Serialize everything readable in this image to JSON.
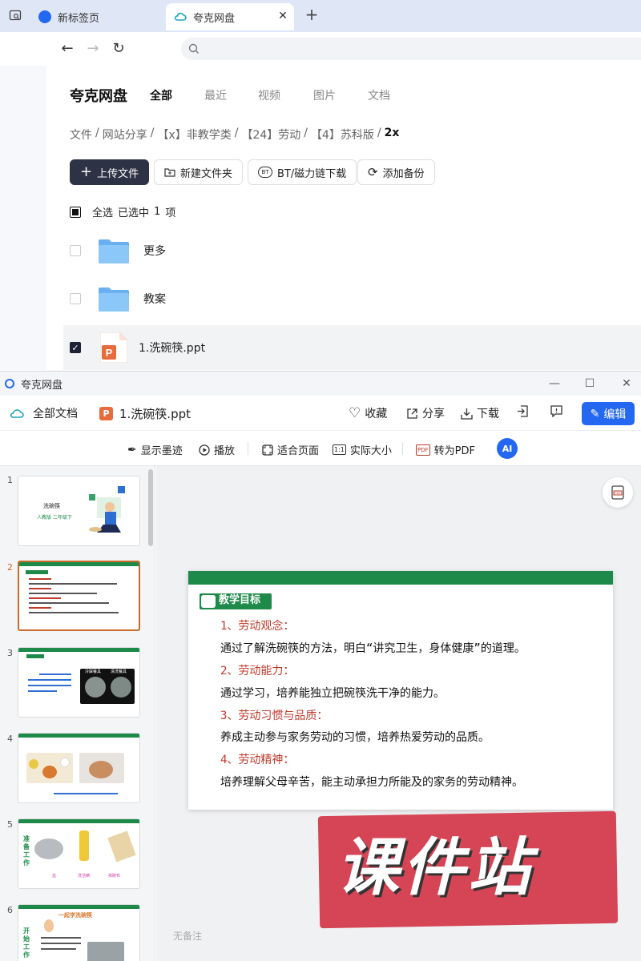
{
  "browser": {
    "tabs": [
      {
        "label": "新标签页"
      },
      {
        "label": "夸克网盘",
        "close": "✕"
      }
    ],
    "new_tab": "+"
  },
  "drive": {
    "brand": "夸克网盘",
    "nav": [
      "全部",
      "最近",
      "视频",
      "图片",
      "文档"
    ],
    "breadcrumb": [
      "文件",
      "/",
      "网站分享",
      "/",
      "【x】非教学类",
      "/",
      "【24】劳动",
      "/",
      "【4】苏科版",
      "/",
      "2x"
    ],
    "actions": {
      "upload": "上传文件",
      "new_folder": "新建文件夹",
      "bt": "BT/磁力链下载",
      "backup": "添加备份"
    },
    "selection": {
      "select_all": "全选",
      "selected": "已选中",
      "count": "1",
      "unit": "项"
    },
    "files": [
      {
        "name": "更多",
        "type": "folder",
        "checked": false
      },
      {
        "name": "教案",
        "type": "folder",
        "checked": false
      },
      {
        "name": "1.洗碗筷.ppt",
        "type": "ppt",
        "checked": true
      }
    ]
  },
  "viewer": {
    "window_title": "夸克网盘",
    "win_controls": {
      "min": "—",
      "max": "☐",
      "close": "✕"
    },
    "all_docs": "全部文档",
    "file_name": "1.洗碗筷.ppt",
    "toolbar": {
      "favorite": "收藏",
      "share": "分享",
      "download": "下载",
      "edit": "编辑"
    },
    "toolbar2": {
      "ink": "显示墨迹",
      "play": "播放",
      "fit": "适合页面",
      "actual": "实际大小",
      "pdf": "转为PDF",
      "ai": "AI"
    },
    "thumb_numbers": [
      "1",
      "2",
      "3",
      "4",
      "5",
      "6"
    ],
    "thumb1": {
      "title": "洗碗筷",
      "sub": "人教版 二年级下"
    },
    "thumb3": {
      "label1": "冷踩餐具",
      "label2": "清洗餐具"
    },
    "thumb5": {
      "side": "准备工作",
      "items": [
        "盆",
        "洗洁精",
        "抹碗布"
      ]
    },
    "thumb6": {
      "title": "一起学洗碗筷",
      "side": "开始工作"
    },
    "notes": "无备注"
  },
  "slide": {
    "ribbon": "教学目标",
    "items": [
      {
        "heading": "1、劳动观念：",
        "body": "通过了解洗碗筷的方法，明白“讲究卫生，身体健康”的道理。"
      },
      {
        "heading": "2、劳动能力：",
        "body": "通过学习，培养能独立把碗筷洗干净的能力。"
      },
      {
        "heading": "3、劳动习惯与品质：",
        "body": "养成主动参与家务劳动的习惯，培养热爱劳动的品质。"
      },
      {
        "heading": "4、劳动精神：",
        "body": "培养理解父母辛苦，能主动承担力所能及的家务的劳动精神。"
      }
    ]
  },
  "watermark": "课件站",
  "colors": {
    "accent": "#2468f2",
    "slide_green": "#1e8a4a",
    "heading_red": "#c0392b",
    "watermark_red": "#d64555"
  }
}
